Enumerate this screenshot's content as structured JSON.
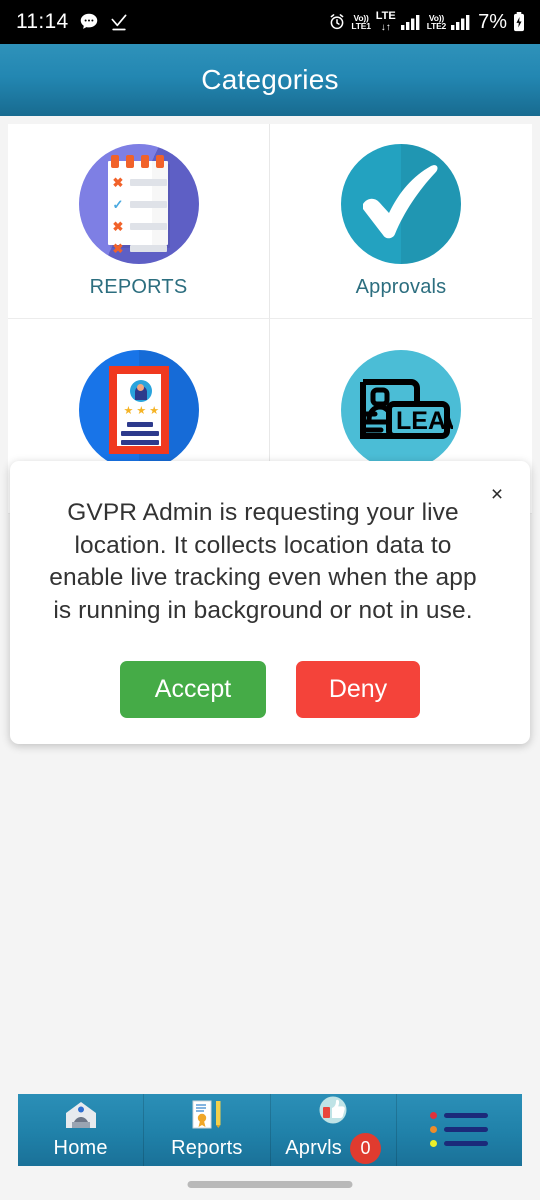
{
  "statusbar": {
    "time": "11:14",
    "icons_left": [
      "message-icon",
      "check-download-icon"
    ],
    "alarm": "alarm-icon",
    "volte1_top": "Vo))",
    "volte1_bottom": "LTE1",
    "lte_top": "LTE",
    "lte_bottom": "↓↑",
    "volte2_top": "Vo))",
    "volte2_bottom": "LTE2",
    "battery": "7%"
  },
  "header": {
    "title": "Categories"
  },
  "grid": {
    "tiles": [
      {
        "label": "REPORTS",
        "icon": "notepad-checklist-icon",
        "color": "#6b6ce0"
      },
      {
        "label": "Approvals",
        "icon": "checkmark-circle-icon",
        "color": "#23a2c0"
      },
      {
        "label": "",
        "icon": "profile-certificate-icon",
        "color": "#1874e8"
      },
      {
        "label": "",
        "icon": "leave-request-icon",
        "color": "#4bbdd6"
      }
    ]
  },
  "dialog": {
    "message": "GVPR Admin is requesting your live location. It collects location data to enable live tracking even when the app is running in background or not in use.",
    "close_icon": "×",
    "accept_label": "Accept",
    "deny_label": "Deny",
    "accept_color": "#45ab47",
    "deny_color": "#f4433a"
  },
  "bottomnav": {
    "items": [
      {
        "label": "Home",
        "icon": "home-icon"
      },
      {
        "label": "Reports",
        "icon": "document-pencil-icon"
      },
      {
        "label": "Aprvls",
        "icon": "thumbs-up-icon",
        "badge": "0"
      },
      {
        "label": "",
        "icon": "menu-list-icon"
      }
    ],
    "badge_color": "#e03b2f"
  }
}
